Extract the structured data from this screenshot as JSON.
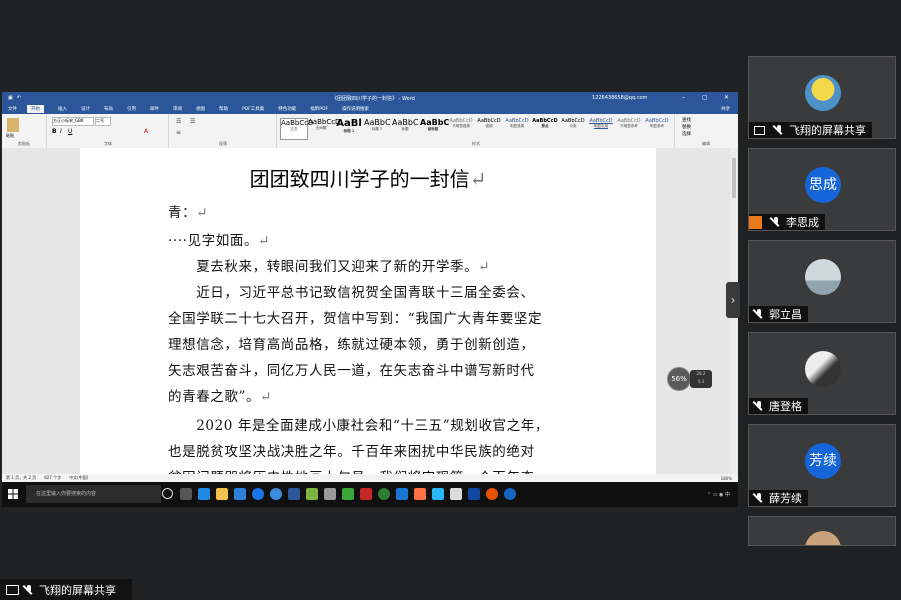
{
  "word": {
    "title": "《团团致四川学子的一封信》 - Word",
    "account": "1226438658@qq.com",
    "tabs": [
      "文件",
      "开始",
      "插入",
      "设计",
      "布局",
      "引用",
      "邮件",
      "审阅",
      "视图",
      "帮助",
      "PDF工具集",
      "特色功能",
      "福昕PDF",
      "操作说明搜索"
    ],
    "active_tab": "开始",
    "share": "共享",
    "font_name": "方正小标宋_GBK",
    "font_size": "二号",
    "group_labels": [
      "剪贴板",
      "字体",
      "段落",
      "样式",
      "编辑"
    ],
    "styles": [
      {
        "preview": "AaBbCcD",
        "name": "正文"
      },
      {
        "preview": "AaBbCcD",
        "name": "无间隔"
      },
      {
        "preview": "AaBl",
        "name": "标题 1"
      },
      {
        "preview": "AaBbC",
        "name": "标题 2"
      },
      {
        "preview": "AaBbC",
        "name": "标题"
      },
      {
        "preview": "AaBbC",
        "name": "副标题"
      },
      {
        "preview": "AaBbCcD",
        "name": "不明显强调"
      },
      {
        "preview": "AaBbCcD",
        "name": "强调"
      },
      {
        "preview": "AaBbCcD",
        "name": "明显强调"
      },
      {
        "preview": "AaBbCcD",
        "name": "要点"
      },
      {
        "preview": "AaBbCcD",
        "name": "引用"
      },
      {
        "preview": "AaBbCcD",
        "name": "明显引用"
      },
      {
        "preview": "AaBbCcD",
        "name": "不明显参考"
      },
      {
        "preview": "AaBbCcD",
        "name": "明显参考"
      }
    ],
    "editing": [
      "查找",
      "替换",
      "选择"
    ],
    "paste": "粘贴",
    "doc_title": "团团致四川学子的一封信",
    "lines": [
      "青：",
      "····见字如面。",
      "　　夏去秋来，转眼间我们又迎来了新的开学季。",
      "　　近日，习近平总书记致信祝贺全国青联十三届全委会、",
      "全国学联二十七大召开，贺信中写到：“我国广大青年要坚定",
      "理想信念，培育高尚品格，练就过硬本领，勇于创新创造，",
      "矢志艰苦奋斗，同亿万人民一道，在矢志奋斗中谱写新时代",
      "的青春之歌”。",
      "　　2020 年是全面建成小康社会和“十三五”规划收官之年，",
      "也是脱贫攻坚决战决胜之年。千百年来困扰中华民族的绝对",
      "贫困问题即将历史性地画上句号，我们将实现第一个百年奋"
    ],
    "status_page": "第 1 页，共 2 页",
    "status_words": "827 个字",
    "status_lang": "中文(中国)",
    "zoom": "180%",
    "badge_value": "56",
    "badge_unit": "%",
    "net_up": "28.2",
    "net_down": "0.3",
    "taskbar_search": "在这里输入你要搜索的内容"
  },
  "bottom_label": "飞翔的屏幕共享",
  "participants": [
    {
      "name": "飞翔的屏幕共享",
      "type": "image",
      "icon": "share"
    },
    {
      "name": "李思成",
      "type": "text",
      "avatar_text": "思成",
      "icon": "user"
    },
    {
      "name": "郭立昌",
      "type": "image",
      "icon": "none"
    },
    {
      "name": "唐登格",
      "type": "image",
      "icon": "none"
    },
    {
      "name": "薛芳续",
      "type": "text",
      "avatar_text": "芳续",
      "icon": "none"
    }
  ],
  "colors": {
    "word_blue": "#2b579a",
    "avatar_blue": "#1565d8",
    "user_badge": "#e87a1c"
  }
}
